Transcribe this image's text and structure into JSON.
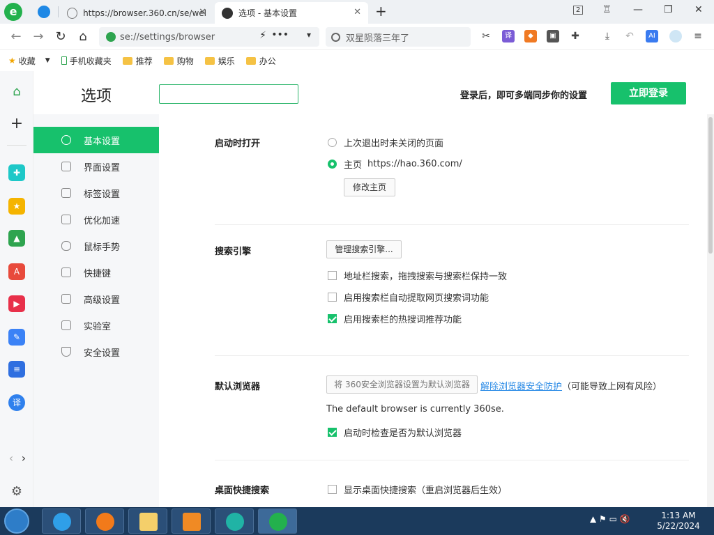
{
  "tabs": [
    {
      "title": "https://browser.360.cn/se/wel",
      "close": "✕"
    },
    {
      "title": "选项 - 基本设置",
      "close": "✕"
    }
  ],
  "newtab": "+",
  "window_controls": {
    "badge": "2",
    "minimize": "—",
    "restore": "❐",
    "close": "✕"
  },
  "address": {
    "url": "se://settings/browser"
  },
  "search": {
    "placeholder": "双星陨落三年了"
  },
  "bookmarks": [
    {
      "label": "收藏"
    },
    {
      "label": "手机收藏夹"
    },
    {
      "label": "推荐"
    },
    {
      "label": "购物"
    },
    {
      "label": "娱乐"
    },
    {
      "label": "办公"
    }
  ],
  "header": {
    "title": "选项",
    "sync_text": "登录后，即可多端同步你的设置",
    "login_button": "立即登录"
  },
  "nav": [
    {
      "label": "基本设置",
      "active": true
    },
    {
      "label": "界面设置"
    },
    {
      "label": "标签设置"
    },
    {
      "label": "优化加速"
    },
    {
      "label": "鼠标手势"
    },
    {
      "label": "快捷键"
    },
    {
      "label": "高级设置"
    },
    {
      "label": "实验室"
    },
    {
      "label": "安全设置"
    }
  ],
  "startup": {
    "label": "启动时打开",
    "option1": "上次退出时未关闭的页面",
    "option2": "主页",
    "homepage_url": "https://hao.360.com/",
    "edit_button": "修改主页"
  },
  "search_engine": {
    "label": "搜索引擎",
    "manage_button": "管理搜索引擎...",
    "opt1": "地址栏搜索，拖拽搜索与搜索栏保持一致",
    "opt2": "启用搜索栏自动提取网页搜索词功能",
    "opt3": "启用搜索栏的热搜词推荐功能"
  },
  "default_browser": {
    "label": "默认浏览器",
    "set_button": "将 360安全浏览器设置为默认浏览器",
    "unlock_link": "解除浏览器安全防护",
    "warning": "（可能导致上网有风险）",
    "current": "The default browser is currently 360se.",
    "check": "启动时检查是否为默认浏览器"
  },
  "desktop_search": {
    "label": "桌面快捷搜索",
    "opt1": "显示桌面快捷搜索（重启浏览器后生效）"
  },
  "clock": {
    "time": "1:13 AM",
    "date": "5/22/2024"
  }
}
